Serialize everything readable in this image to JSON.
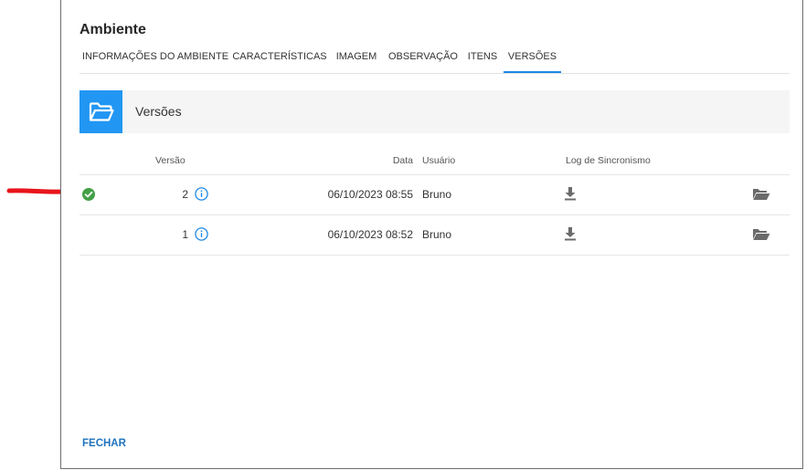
{
  "dialog": {
    "title": "Ambiente",
    "close_label": "FECHAR"
  },
  "tabs": [
    {
      "label": "INFORMAÇÕES DO AMBIENTE",
      "active": false
    },
    {
      "label": "CARACTERÍSTICAS",
      "active": false
    },
    {
      "label": "IMAGEM",
      "active": false
    },
    {
      "label": "OBSERVAÇÃO",
      "active": false
    },
    {
      "label": "ITENS",
      "active": false
    },
    {
      "label": "VERSÕES",
      "active": true
    }
  ],
  "section": {
    "title": "Versões",
    "icon": "folder-open-icon"
  },
  "table": {
    "columns": [
      "Versão",
      "Data",
      "Usuário",
      "Log de Sincronismo"
    ],
    "rows": [
      {
        "version": "2",
        "date": "06/10/2023 08:55",
        "user": "Bruno",
        "current": true
      },
      {
        "version": "1",
        "date": "06/10/2023 08:52",
        "user": "Bruno",
        "current": false
      }
    ]
  },
  "colors": {
    "accent": "#1e88e5",
    "tile": "#2196f3",
    "check": "#43a047",
    "annotation": "#e8151b",
    "link": "#1e73be"
  }
}
